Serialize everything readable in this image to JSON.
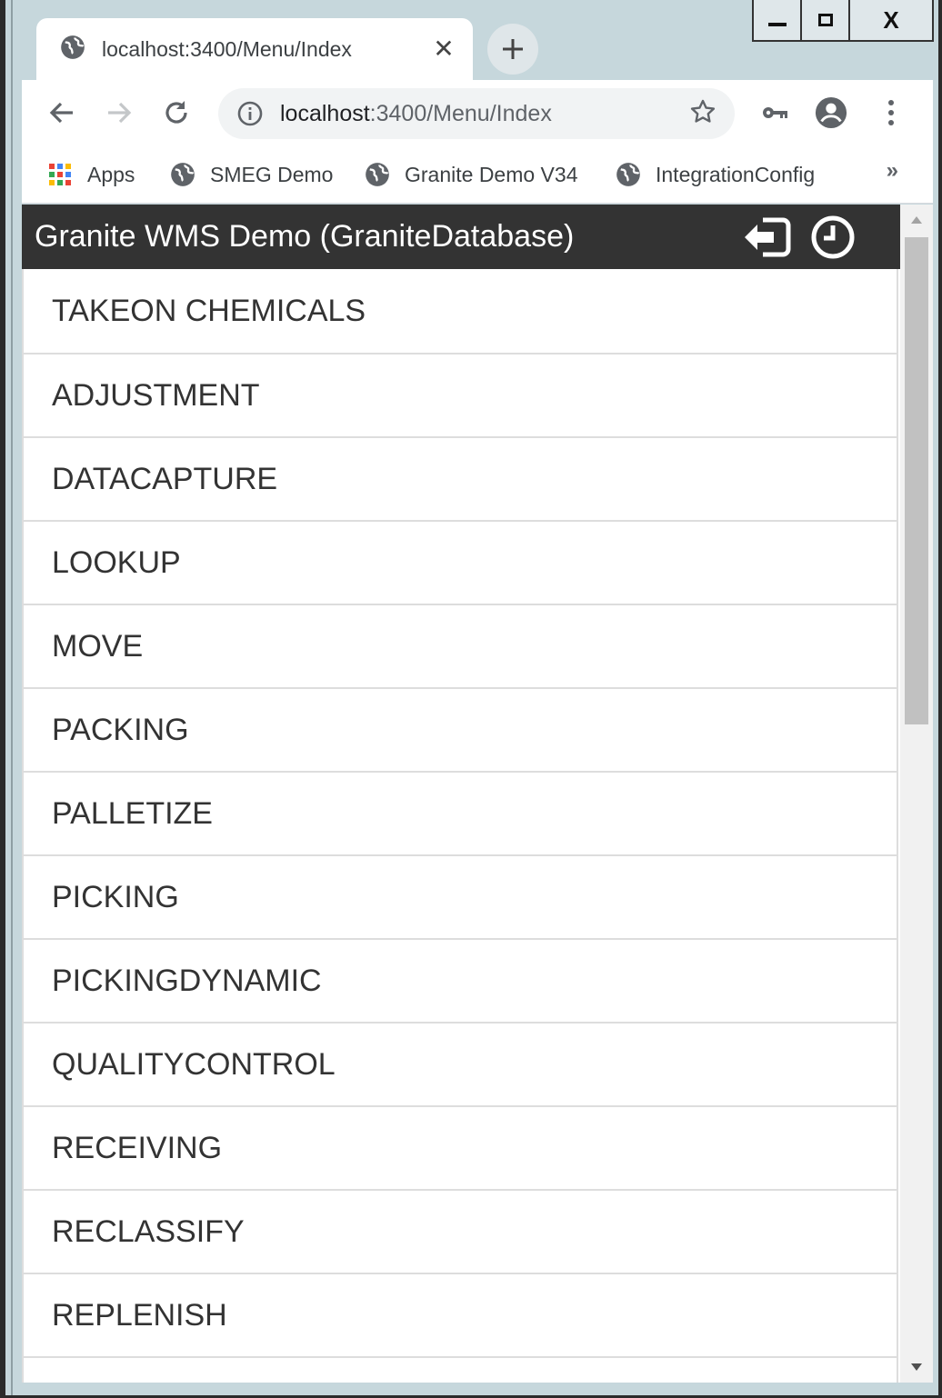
{
  "window": {
    "controls": {
      "minimize": "minimize-window",
      "maximize": "maximize-window",
      "close_label": "X"
    }
  },
  "browser": {
    "tab": {
      "title": "localhost:3400/Menu/Index",
      "close_label": "✕"
    },
    "new_tab_label": "+",
    "omnibox": {
      "host": "localhost",
      "path": ":3400/Menu/Index"
    },
    "bookmarks": [
      {
        "label": "Apps",
        "icon": "apps-grid-icon"
      },
      {
        "label": "SMEG Demo",
        "icon": "globe-icon"
      },
      {
        "label": "Granite Demo V34",
        "icon": "globe-icon"
      },
      {
        "label": "IntegrationConfig",
        "icon": "globe-icon"
      }
    ],
    "bookmarks_more": "»"
  },
  "app": {
    "title": "Granite WMS Demo (GraniteDatabase)",
    "header_icons": [
      "logout-icon",
      "clock-icon"
    ],
    "menu": [
      "TAKEON CHEMICALS",
      "ADJUSTMENT",
      "DATACAPTURE",
      "LOOKUP",
      "MOVE",
      "PACKING",
      "PALLETIZE",
      "PICKING",
      "PICKINGDYNAMIC",
      "QUALITYCONTROL",
      "RECEIVING",
      "RECLASSIFY",
      "REPLENISH",
      ""
    ]
  },
  "colors": {
    "header_bg": "#333333",
    "chrome_bg": "#c6d7dc",
    "menu_text": "#333333",
    "divider": "#dddddd"
  }
}
